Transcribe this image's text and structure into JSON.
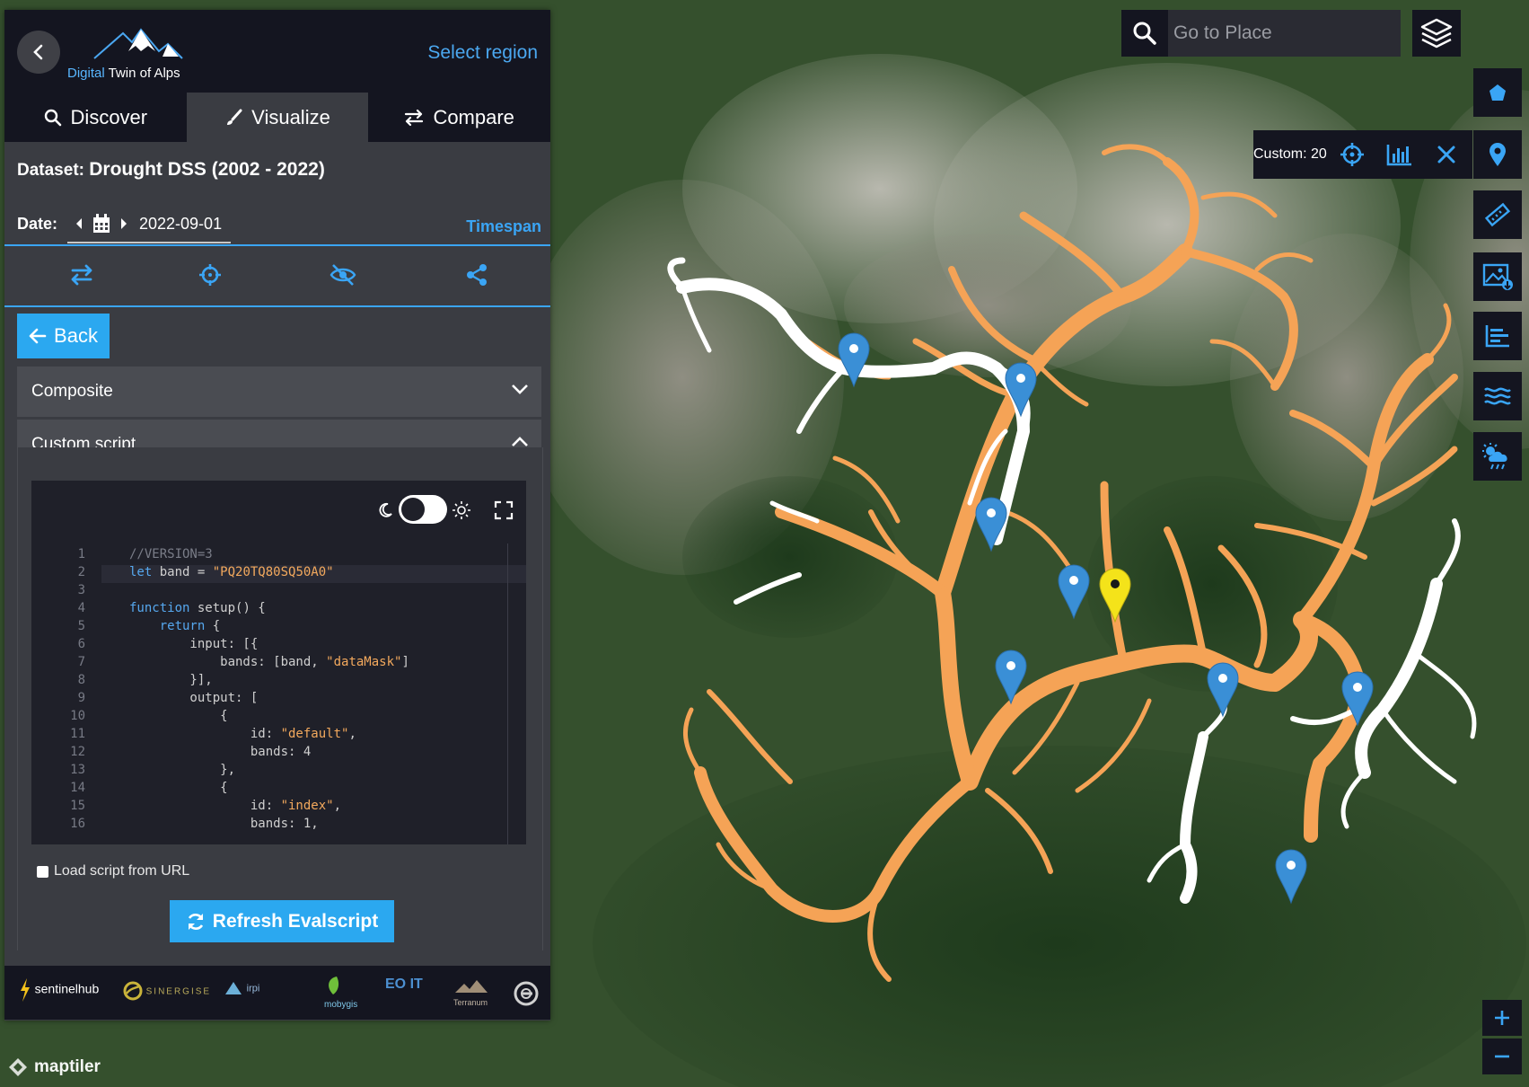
{
  "header": {
    "logo_prefix": "Digital",
    "logo_suffix": "Twin of Alps",
    "select_region": "Select region"
  },
  "tabs": [
    {
      "label": "Discover",
      "icon": "search-icon"
    },
    {
      "label": "Visualize",
      "icon": "brush-icon",
      "active": true
    },
    {
      "label": "Compare",
      "icon": "swap-icon"
    }
  ],
  "dataset": {
    "label": "Dataset:",
    "value": "Drought DSS (2002 - 2022)"
  },
  "date": {
    "label": "Date:",
    "value": "2022-09-01",
    "timespan": "Timespan"
  },
  "toolbar_icons": [
    "swap-icon",
    "crosshair-icon",
    "eye-slash-icon",
    "share-icon"
  ],
  "back_button": "Back",
  "accordion": {
    "composite": "Composite",
    "custom_script": "Custom script"
  },
  "code": [
    {
      "n": "1",
      "html": "<span class='cm'>//VERSION=3</span>"
    },
    {
      "n": "2",
      "html": "<span class='kw'>let</span> band = <span class='str'>\"PQ20TQ80SQ50A0\"</span>"
    },
    {
      "n": "3",
      "html": ""
    },
    {
      "n": "4",
      "html": "<span class='kw'>function</span> setup() {"
    },
    {
      "n": "5",
      "html": "    <span class='kw'>return</span> {"
    },
    {
      "n": "6",
      "html": "        input: [{"
    },
    {
      "n": "7",
      "html": "            bands: [band, <span class='str'>\"dataMask\"</span>]"
    },
    {
      "n": "8",
      "html": "        }],"
    },
    {
      "n": "9",
      "html": "        output: ["
    },
    {
      "n": "10",
      "html": "            {"
    },
    {
      "n": "11",
      "html": "                id: <span class='str'>\"default\"</span>,"
    },
    {
      "n": "12",
      "html": "                bands: 4"
    },
    {
      "n": "13",
      "html": "            },"
    },
    {
      "n": "14",
      "html": "            {"
    },
    {
      "n": "15",
      "html": "                id: <span class='str'>\"index\"</span>,"
    },
    {
      "n": "16",
      "html": "                bands: 1,"
    }
  ],
  "load_from_url": "Load script from URL",
  "refresh_button": "Refresh Evalscript",
  "footer_logos": [
    "sentinelhub",
    "SINERGISE",
    "irpi",
    "mobygis",
    "EO IT",
    "Terranum"
  ],
  "search": {
    "placeholder": "Go to Place"
  },
  "custom_bar": {
    "label": "Custom: 20"
  },
  "attribution": "maptiler",
  "colors": {
    "accent": "#2ba8f0",
    "river_dry": "#f5a356",
    "river_wet": "#ffffff",
    "marker": "#3a8fd6",
    "marker_selected": "#f4e31a"
  }
}
